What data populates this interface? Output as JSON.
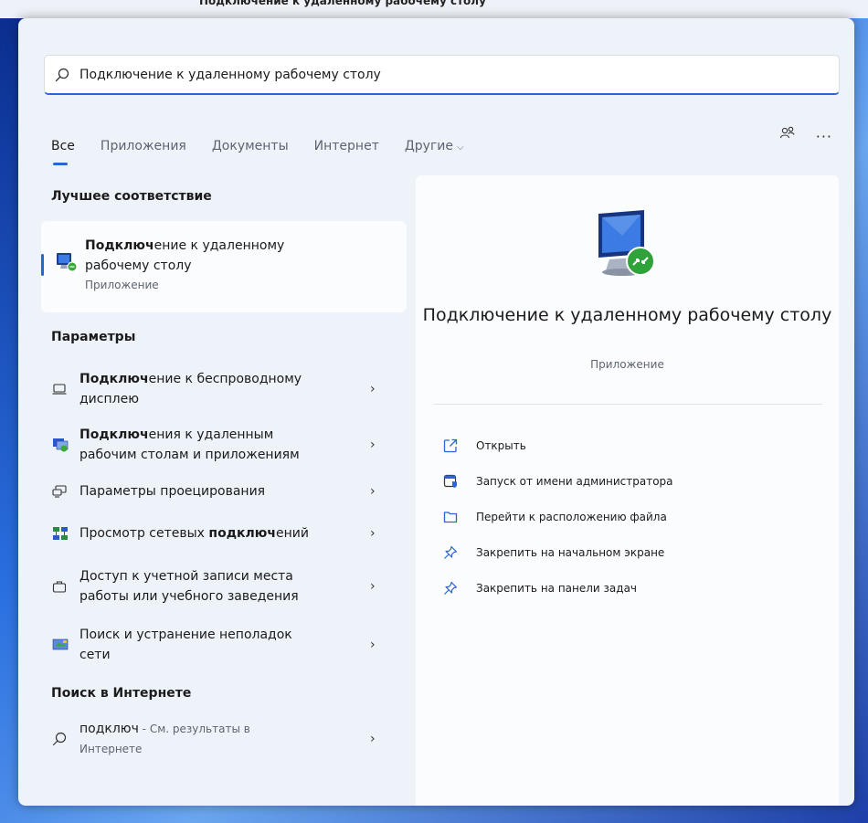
{
  "top_snippet": {
    "left_text": "",
    "title": "Подключение к удаленному рабочему столу"
  },
  "search": {
    "value": "Подключение к удаленному рабочему столу",
    "placeholder": ""
  },
  "tabs": [
    {
      "label": "Все",
      "active": true
    },
    {
      "label": "Приложения"
    },
    {
      "label": "Документы"
    },
    {
      "label": "Интернет"
    },
    {
      "label": "Другие"
    }
  ],
  "best_match": {
    "section_title": "Лучшее соответствие",
    "title_bold": "Подключ",
    "title_rest_1": "ение к удаленному",
    "title_line2": "рабочему столу",
    "kind": "Приложение"
  },
  "settings": {
    "section_title": "Параметры",
    "items": [
      {
        "bold": "Подключ",
        "rest": "ение к беспроводному",
        "line2": "дисплею"
      },
      {
        "bold": "Подключ",
        "rest": "ения к удаленным",
        "line2": "рабочим столам и приложениям"
      },
      {
        "text": "Параметры проецирования"
      },
      {
        "pre": "Просмотр сетевых ",
        "bold": "подключ",
        "post": "ений"
      },
      {
        "text": "Доступ к учетной записи места",
        "line2": "работы или учебного заведения"
      },
      {
        "text": "Поиск и устранение неполадок",
        "line2": "сети"
      }
    ]
  },
  "web": {
    "section_title": "Поиск в Интернете",
    "query": "подключ",
    "suffix": " - См. результаты в",
    "line2": "Интернете"
  },
  "details": {
    "title": "Подключение к удаленному рабочему столу",
    "kind": "Приложение",
    "actions": [
      {
        "label": "Открыть",
        "icon": "open-external-icon"
      },
      {
        "label": "Запуск от имени администратора",
        "icon": "admin-shield-icon"
      },
      {
        "label": "Перейти к расположению файла",
        "icon": "folder-icon"
      },
      {
        "label": "Закрепить на начальном экране",
        "icon": "pin-icon"
      },
      {
        "label": "Закрепить на панели задач",
        "icon": "pin-icon"
      }
    ]
  },
  "colors": {
    "accent": "#2b64d6",
    "panel_bg": "#eef2f9",
    "card_bg": "#fbfcfe"
  }
}
